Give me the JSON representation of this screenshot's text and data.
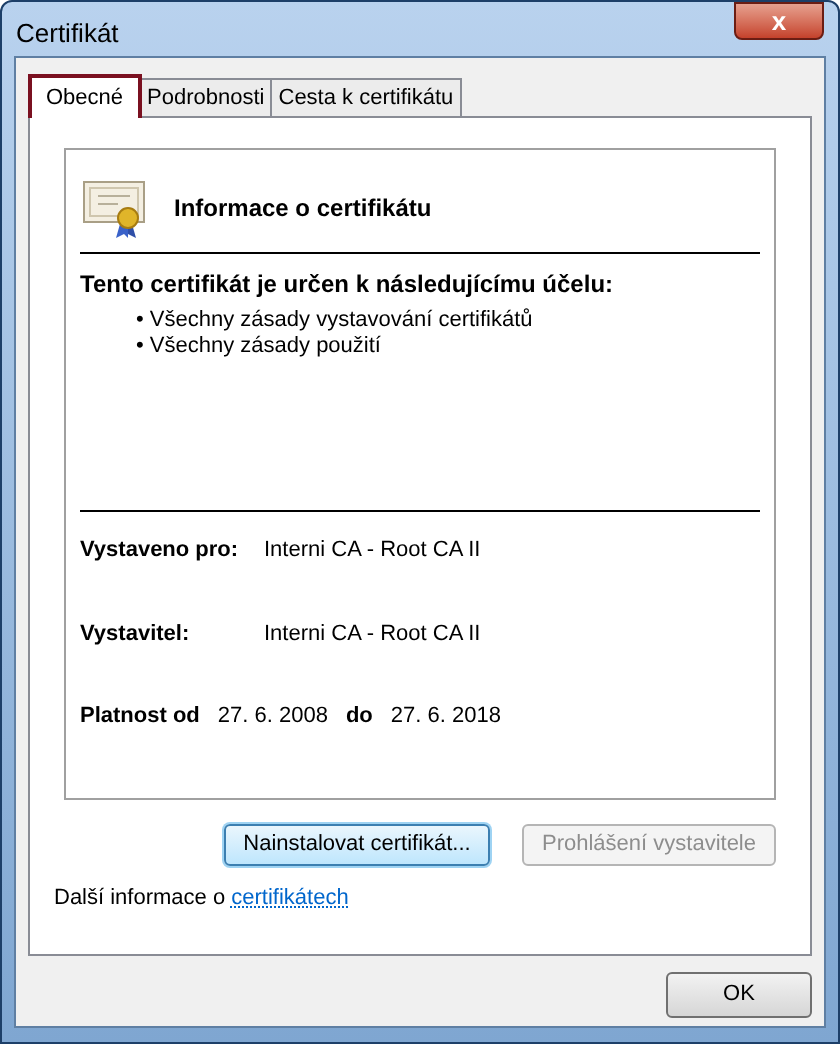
{
  "window": {
    "title": "Certifikát",
    "close": "x"
  },
  "tabs": [
    {
      "label": "Obecné",
      "selected": true
    },
    {
      "label": "Podrobnosti",
      "selected": false
    },
    {
      "label": "Cesta k certifikátu",
      "selected": false
    }
  ],
  "info": {
    "heading": "Informace o certifikátu",
    "purpose_title": "Tento certifikát je určen k následujícímu účelu:",
    "purposes": [
      "• Všechny zásady vystavování certifikátů",
      "• Všechny zásady použití"
    ],
    "issued_to_label": "Vystaveno pro:",
    "issued_to": "Interni CA - Root CA II",
    "issuer_label": "Vystavitel:",
    "issuer": "Interni CA - Root CA II",
    "valid_from_label": "Platnost od",
    "valid_from": "27. 6. 2008",
    "valid_to_label": "do",
    "valid_to": "27. 6. 2018"
  },
  "buttons": [
    {
      "label": "Nainstalovat certifikát...",
      "disabled": false,
      "focused": true
    },
    {
      "label": "Prohlášení vystavitele",
      "disabled": true,
      "focused": false
    }
  ],
  "more_info": {
    "text": "Další informace o",
    "link": "certifikátech"
  },
  "ok_button": "OK"
}
